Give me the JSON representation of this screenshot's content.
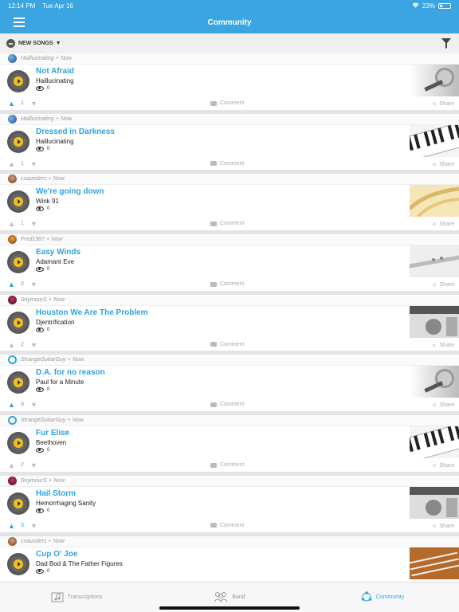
{
  "status": {
    "time": "12:14 PM",
    "date": "Tue Apr 16",
    "battery": "23%"
  },
  "nav": {
    "title": "Community"
  },
  "filter": {
    "label": "NEW SONGS"
  },
  "colors": {
    "accent": "#3aa5e0",
    "title": "#2ea3dc"
  },
  "posts": [
    {
      "author": "Haillucinating",
      "time": "Now",
      "title": "Not Afraid",
      "artist": "Haillucinating",
      "views": "0",
      "votes": "1",
      "voted": true,
      "thumb": "mic",
      "avatar": "globe"
    },
    {
      "author": "Haillucinating",
      "time": "Now",
      "title": "Dressed in Darkness",
      "artist": "Haillucinating",
      "views": "0",
      "votes": "1",
      "voted": false,
      "thumb": "piano",
      "avatar": "globe"
    },
    {
      "author": "csaunders",
      "time": "Now",
      "title": "We're going down",
      "artist": "Wink 91",
      "views": "0",
      "votes": "1",
      "voted": false,
      "thumb": "sheet",
      "avatar": "person"
    },
    {
      "author": "Fred1987",
      "time": "Now",
      "title": "Easy Winds",
      "artist": "Adamant Eve",
      "views": "0",
      "votes": "2",
      "voted": true,
      "thumb": "flute",
      "avatar": "hat"
    },
    {
      "author": "SeymourS",
      "time": "Now",
      "title": "Houston We Are The Problem",
      "artist": "Djentrification",
      "views": "0",
      "votes": "2",
      "voted": false,
      "thumb": "amp",
      "avatar": "guitar"
    },
    {
      "author": "StrangeGuitarGuy",
      "time": "Now",
      "title": "D.A. for no reason",
      "artist": "Paul for a Minute",
      "views": "0",
      "votes": "3",
      "voted": true,
      "thumb": "mic",
      "avatar": "headphones"
    },
    {
      "author": "StrangeGuitarGuy",
      "time": "Now",
      "title": "Fur Elise",
      "artist": "Beethoven",
      "views": "0",
      "votes": "2",
      "voted": false,
      "thumb": "piano",
      "avatar": "headphones"
    },
    {
      "author": "SeymourS",
      "time": "Now",
      "title": "Hail Storm",
      "artist": "Hemorrhaging Sanity",
      "views": "0",
      "votes": "3",
      "voted": true,
      "thumb": "amp",
      "avatar": "guitar"
    },
    {
      "author": "csaunders",
      "time": "Now",
      "title": "Cup O' Joe",
      "artist": "Dad Bod & The Father Figures",
      "views": "0",
      "votes": "",
      "voted": false,
      "thumb": "guitar",
      "avatar": "person"
    }
  ],
  "actions": {
    "comment": "Comment",
    "share": "Share"
  },
  "tabs": [
    {
      "label": "Transcriptions",
      "icon": "music-folder-icon"
    },
    {
      "label": "Band",
      "icon": "band-icon"
    },
    {
      "label": "Community",
      "icon": "community-icon"
    }
  ],
  "active_tab": "Community"
}
